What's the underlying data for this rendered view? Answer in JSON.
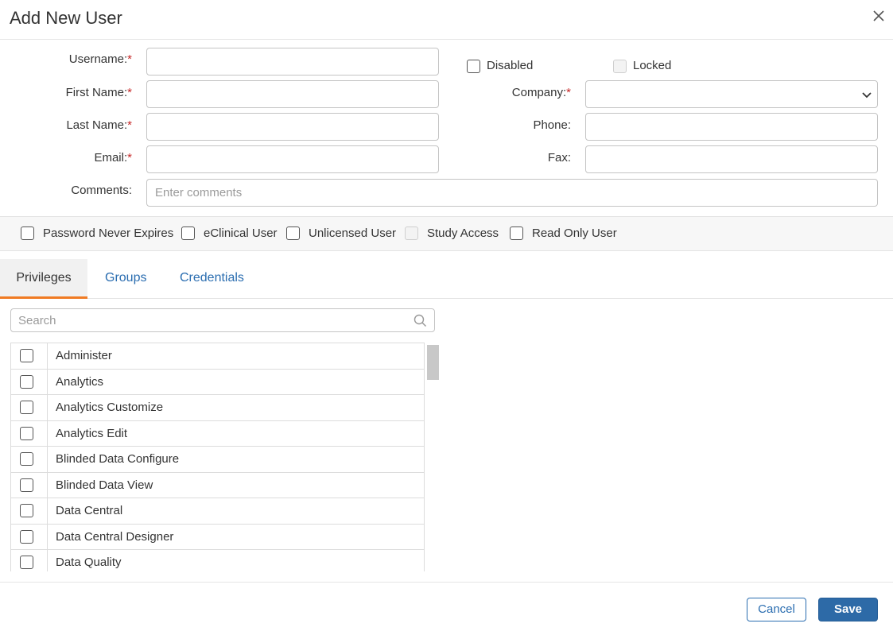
{
  "dialog": {
    "title": "Add New User"
  },
  "form": {
    "username_label": "Username:",
    "first_name_label": "First Name:",
    "last_name_label": "Last Name:",
    "email_label": "Email:",
    "comments_label": "Comments:",
    "comments_placeholder": "Enter comments",
    "company_label": "Company:",
    "phone_label": "Phone:",
    "fax_label": "Fax:",
    "required_marker": "*",
    "disabled_label": "Disabled",
    "locked_label": "Locked"
  },
  "options": {
    "password_never_expires": "Password Never Expires",
    "eclinical_user": "eClinical User",
    "unlicensed_user": "Unlicensed User",
    "study_access": "Study Access",
    "read_only_user": "Read Only User"
  },
  "tabs": [
    {
      "label": "Privileges"
    },
    {
      "label": "Groups"
    },
    {
      "label": "Credentials"
    }
  ],
  "search": {
    "placeholder": "Search"
  },
  "privileges": [
    {
      "name": "Administer"
    },
    {
      "name": "Analytics"
    },
    {
      "name": "Analytics Customize"
    },
    {
      "name": "Analytics Edit"
    },
    {
      "name": "Blinded Data Configure"
    },
    {
      "name": "Blinded Data View"
    },
    {
      "name": "Data Central"
    },
    {
      "name": "Data Central Designer"
    },
    {
      "name": "Data Quality"
    }
  ],
  "footer": {
    "cancel_label": "Cancel",
    "save_label": "Save"
  },
  "colors": {
    "accent_tab": "#f07b24",
    "link": "#2a6db0",
    "primary_button": "#2d6aa7",
    "required": "#c62828"
  }
}
